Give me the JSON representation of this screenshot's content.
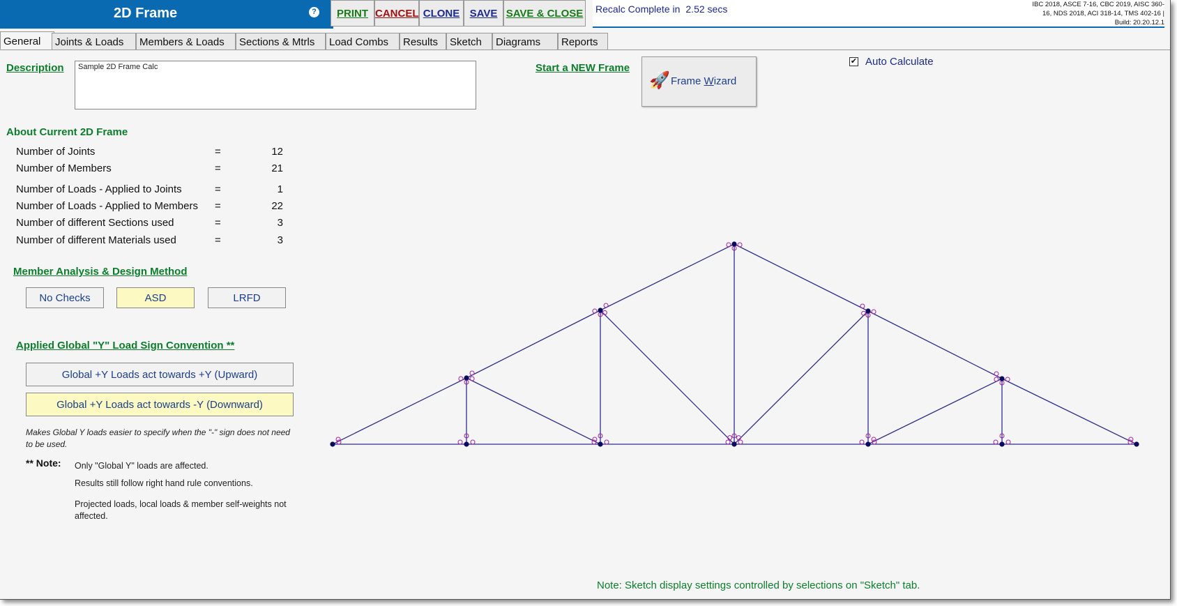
{
  "app": {
    "title": "2D Frame",
    "help_glyph": "?"
  },
  "toolbar": {
    "print": "PRINT",
    "cancel": "CANCEL",
    "clone": "CLONE",
    "save": "SAVE",
    "save_close": "SAVE & CLOSE"
  },
  "status": {
    "recalc_label": "Recalc Complete in",
    "recalc_time": "2.52 secs",
    "codes_line1": "IBC 2018, ASCE 7-16, CBC 2019, AISC 360-",
    "codes_line2": "16, NDS 2018, ACI 318-14, TMS 402-16 |",
    "codes_line3": "Build: 20.20.12.1"
  },
  "tabs": [
    "General",
    "Joints & Loads",
    "Members & Loads",
    "Sections & Mtrls",
    "Load Combs",
    "Results",
    "Sketch",
    "Diagrams",
    "Reports"
  ],
  "description": {
    "link": "Description",
    "value": "Sample 2D Frame Calc"
  },
  "new_frame": {
    "link": "Start a NEW Frame",
    "wizard_pre": "Frame ",
    "wizard_underlined": "W",
    "wizard_post": "izard",
    "icon": "rocket-icon"
  },
  "auto_calc": {
    "label": "Auto Calculate",
    "checked": true,
    "check_glyph": "✔"
  },
  "about": {
    "heading": "About Current 2D Frame",
    "eq": "=",
    "stats": [
      {
        "label": "Number of Joints",
        "value": "12"
      },
      {
        "label": "Number of Members",
        "value": "21"
      },
      {
        "label": "Number of Loads - Applied to Joints",
        "value": "1"
      },
      {
        "label": "Number of Loads - Applied to Members",
        "value": "22"
      },
      {
        "label": "Number of different Sections used",
        "value": "3"
      },
      {
        "label": "Number of different Materials used",
        "value": "3"
      }
    ]
  },
  "method": {
    "heading": "Member Analysis & Design Method",
    "options": [
      "No Checks",
      "ASD",
      "LRFD"
    ],
    "selected": "ASD"
  },
  "sign": {
    "heading": "Applied Global \"Y\" Load Sign Convention  **",
    "up": "Global +Y Loads act towards  +Y  (Upward)",
    "down": "Global +Y Loads act towards  -Y  (Downward)",
    "selected": "down",
    "italic_note": "Makes Global Y loads easier to specify when the \"-\" sign does not need to be used.",
    "note_label": "** Note:",
    "note1": "Only \"Global Y\" loads are affected.",
    "note2": "Results still follow right hand rule conventions.",
    "note3": "Projected loads, local loads & member self-weights not affected."
  },
  "sketch_note": "Note: Sketch display settings controlled by selections on \"Sketch\" tab.",
  "colors": {
    "title_bar": "#0a6ab1",
    "link_green": "#0d7d2c",
    "selected_fill": "#fdf9c3",
    "member_line": "#2e2e8c",
    "joint": "#0b0b5e",
    "hinge": "#a020a0"
  }
}
